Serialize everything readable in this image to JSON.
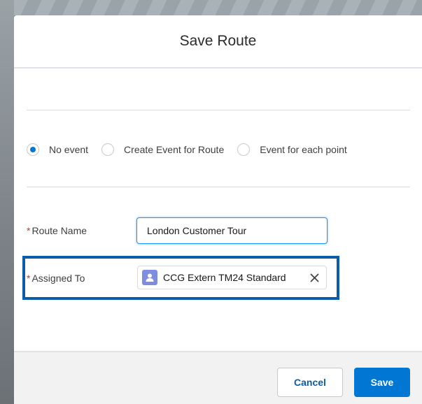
{
  "dialog": {
    "title": "Save Route"
  },
  "event_options": [
    {
      "label": "No event",
      "selected": true
    },
    {
      "label": "Create Event for Route",
      "selected": false
    },
    {
      "label": "Event for each point",
      "selected": false
    }
  ],
  "fields": {
    "route_name": {
      "required_marker": "*",
      "label": "Route Name",
      "value": "London Customer Tour"
    },
    "assigned_to": {
      "required_marker": "*",
      "label": "Assigned To",
      "value": "CCG Extern TM24 Standard",
      "icon": "user-avatar-icon",
      "clear_icon": "close-icon"
    }
  },
  "footer": {
    "cancel_label": "Cancel",
    "save_label": "Save"
  },
  "colors": {
    "brand": "#0176d3",
    "highlight_border": "#0b5cab",
    "avatar": "#7f8de1",
    "required": "#c23934"
  }
}
